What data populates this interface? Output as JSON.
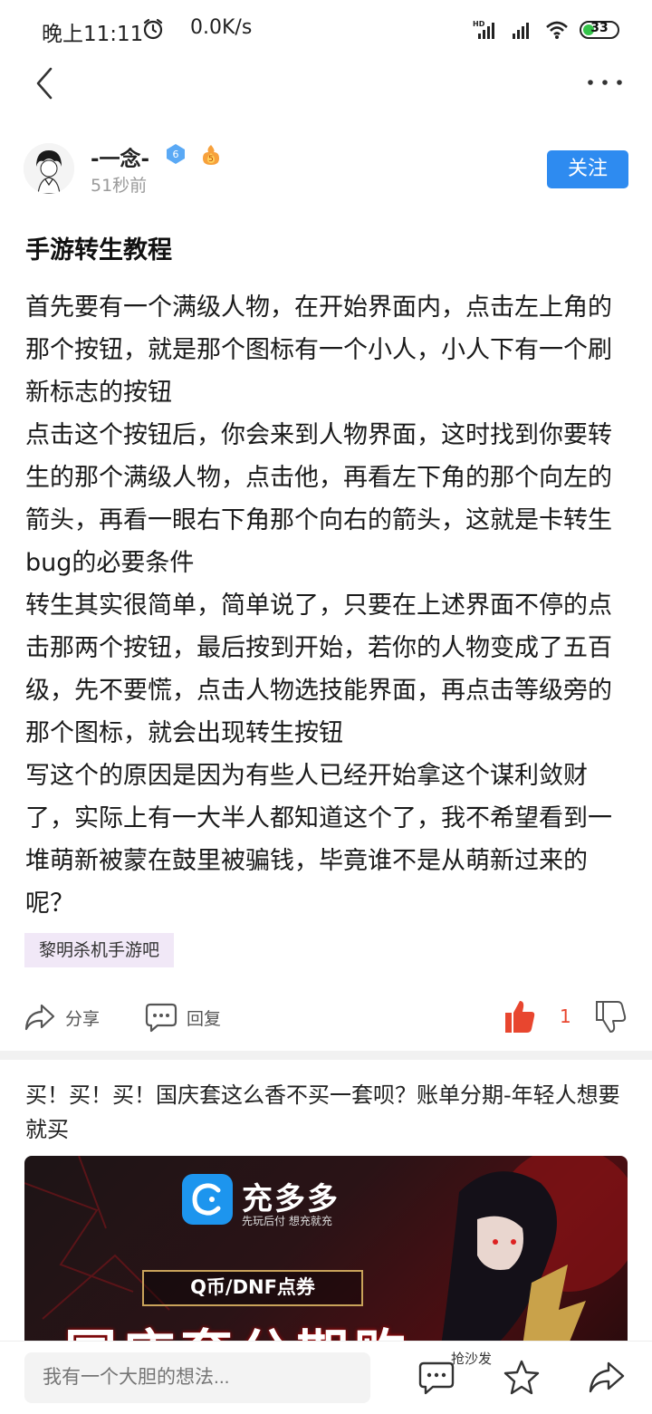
{
  "status_bar": {
    "time": "晚上11:11",
    "net_speed": "0.0K/s",
    "battery": "33",
    "battery_level": 0.33,
    "icons": [
      "alarm-icon",
      "hd-signal-icon",
      "signal-icon",
      "wifi-icon",
      "battery-icon"
    ]
  },
  "topbar": {
    "icons": [
      "back-arrow-icon",
      "more-icon"
    ]
  },
  "author": {
    "name": "-一念-",
    "level": "6",
    "fire_level": "5",
    "time_ago": "51秒前",
    "follow_label": "关注"
  },
  "post": {
    "title": "手游转生教程",
    "paragraphs": [
      "首先要有一个满级人物，在开始界面内，点击左上角的那个按钮，就是那个图标有一个小人，小人下有一个刷新标志的按钮",
      "点击这个按钮后，你会来到人物界面，这时找到你要转生的那个满级人物，点击他，再看左下角的那个向左的箭头，再看一眼右下角那个向右的箭头，这就是卡转生bug的必要条件",
      "转生其实很简单，简单说了，只要在上述界面不停的点击那两个按钮，最后按到开始，若你的人物变成了五百级，先不要慌，点击人物选技能界面，再点击等级旁的那个图标，就会出现转生按钮",
      "写这个的原因是因为有些人已经开始拿这个谋利敛财了，实际上有一大半人都知道这个了，我不希望看到一堆萌新被蒙在鼓里被骗钱，毕竟谁不是从萌新过来的呢？"
    ],
    "tag": "黎明杀机手游吧"
  },
  "actions": {
    "share_label": "分享",
    "reply_label": "回复",
    "like_count": "1"
  },
  "ad": {
    "title": "买！买！买！国庆套这么香不买一套呗？账单分期-年轻人想要就买",
    "brand": "充多多",
    "slogan": "先玩后付 想充就充",
    "pill_text": "Q币/DNF点券",
    "headline": "国庆套分期购"
  },
  "bottom_bar": {
    "comment_placeholder": "我有一个大胆的想法...",
    "sofa_label": "抢沙发"
  },
  "colors": {
    "accent_blue": "#2e8bf0",
    "like_red": "#e8462f",
    "tag_bg": "#f1e8f7"
  }
}
